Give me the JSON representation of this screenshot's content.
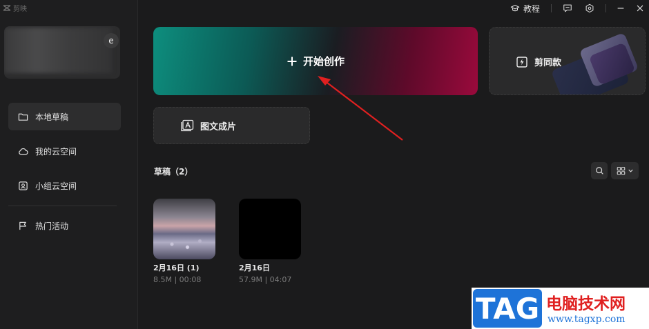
{
  "app": {
    "name": "剪映"
  },
  "topbar": {
    "tutorial": "教程"
  },
  "profile": {
    "badge": "e"
  },
  "sidebar": {
    "items": [
      {
        "label": "本地草稿",
        "icon": "folder-icon",
        "active": true
      },
      {
        "label": "我的云空间",
        "icon": "cloud-icon",
        "active": false
      },
      {
        "label": "小组云空间",
        "icon": "team-cloud-icon",
        "active": false
      },
      {
        "label": "热门活动",
        "icon": "flag-icon",
        "active": false
      }
    ]
  },
  "main": {
    "start_label": "开始创作",
    "template_label": "剪同款",
    "graphic_label": "图文成片",
    "drafts_title": "草稿（2）"
  },
  "drafts": [
    {
      "name": "2月16日 (1)",
      "meta": "8.5M | 00:08"
    },
    {
      "name": "2月16日",
      "meta": "57.9M | 04:07"
    }
  ],
  "watermark": {
    "logo": "TAG",
    "site_cn": "电脑技术网",
    "url": "www.tagxp.com"
  },
  "colors": {
    "start_left": "#0d8e7e",
    "start_right": "#9a0a3c",
    "arrow": "#e02020"
  }
}
